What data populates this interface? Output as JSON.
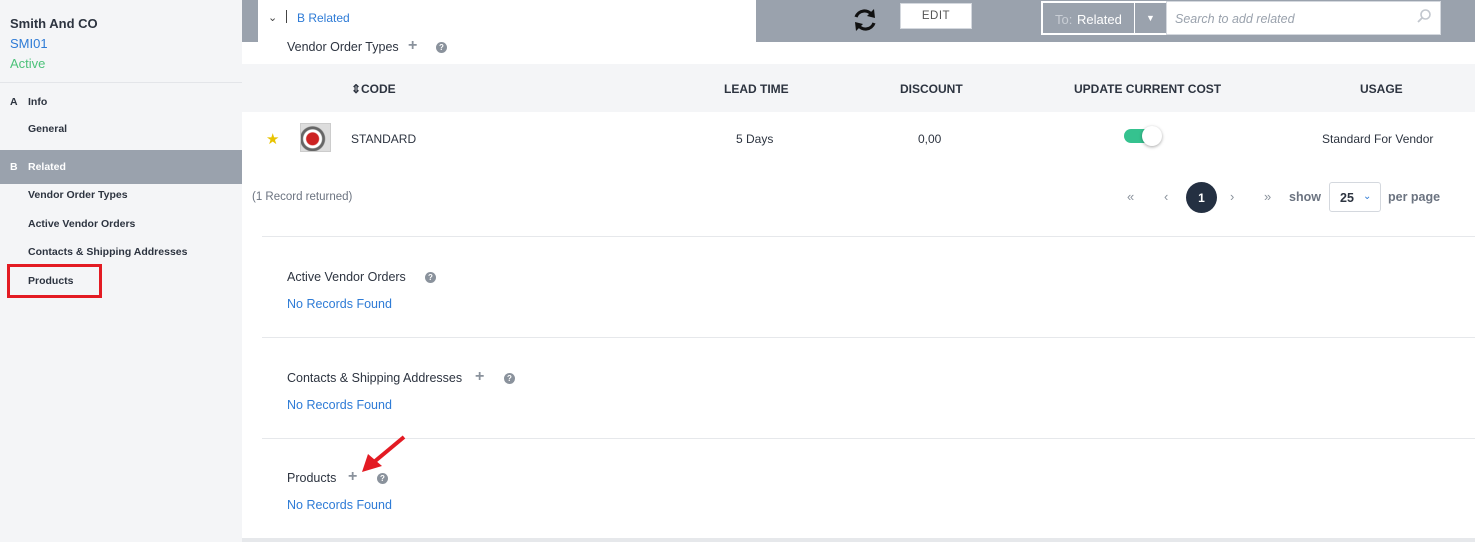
{
  "sidebar": {
    "company_name": "Smith And CO",
    "company_code": "SMI01",
    "status": "Active",
    "sections": [
      {
        "letter": "A",
        "label": "Info",
        "items": [
          "General"
        ]
      },
      {
        "letter": "B",
        "label": "Related",
        "items": [
          "Vendor Order Types",
          "Active Vendor Orders",
          "Contacts & Shipping Addresses",
          "Products"
        ]
      }
    ]
  },
  "toolbar": {
    "tab_label": "B Related",
    "edit_label": "EDIT",
    "to_label": "To:",
    "to_value": "Related",
    "search_placeholder": "Search to add related"
  },
  "vendor_order_types": {
    "title": "Vendor Order Types",
    "columns": [
      "CODE",
      "LEAD TIME",
      "DISCOUNT",
      "UPDATE CURRENT COST",
      "USAGE"
    ],
    "rows": [
      {
        "code": "STANDARD",
        "lead_time": "5  Days",
        "discount": "0,00",
        "update_current_cost": true,
        "usage": "Standard For Vendor"
      }
    ],
    "records_text": "(1 Record returned)",
    "pagination": {
      "current_page": "1",
      "show_label": "show",
      "per_page_value": "25",
      "per_page_label": "per page"
    }
  },
  "active_vendor_orders": {
    "title": "Active Vendor Orders",
    "empty_text": "No Records Found"
  },
  "contacts": {
    "title": "Contacts & Shipping Addresses",
    "empty_text": "No Records Found"
  },
  "products": {
    "title": "Products",
    "empty_text": "No Records Found"
  },
  "colors": {
    "accent_blue": "#2e7bd6",
    "active_green": "#4cc27a",
    "toggle_on": "#35c28f",
    "highlight_red": "#e31b23"
  }
}
